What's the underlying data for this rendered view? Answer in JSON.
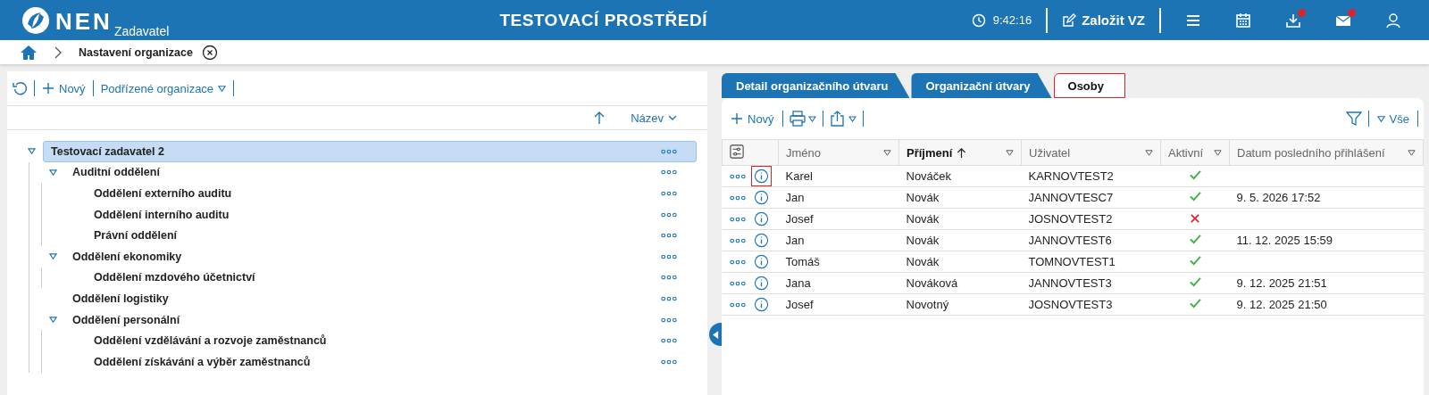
{
  "header": {
    "logo": "NEN",
    "subtitle": "Zadavatel",
    "environment": "TESTOVACÍ PROSTŘEDÍ",
    "time": "9:42:16",
    "create_button": "Založit VZ",
    "icons": [
      {
        "kind": "menu",
        "notification": false
      },
      {
        "kind": "calendar",
        "notification": false
      },
      {
        "kind": "download",
        "notification": true
      },
      {
        "kind": "mail",
        "notification": true
      },
      {
        "kind": "user",
        "notification": false
      }
    ]
  },
  "breadcrumb": {
    "current": "Nastavení organizace"
  },
  "tree_toolbar": {
    "new": "Nový",
    "subordinate": "Podřízené organizace"
  },
  "sort": {
    "label": "Název"
  },
  "tree": [
    {
      "label": "Testovací zadavatel 2",
      "selected": true,
      "expanded": true,
      "children": [
        {
          "label": "Auditní oddělení",
          "selected": false,
          "expanded": true,
          "children": [
            {
              "label": "Oddělení externího auditu",
              "selected": false
            },
            {
              "label": "Oddělení interního auditu",
              "selected": false
            },
            {
              "label": "Právní oddělení",
              "selected": false
            }
          ]
        },
        {
          "label": "Oddělení ekonomiky",
          "selected": false,
          "expanded": true,
          "children": [
            {
              "label": "Oddělení mzdového účetnictví",
              "selected": false
            }
          ]
        },
        {
          "label": "Oddělení logistiky",
          "selected": false
        },
        {
          "label": "Oddělení personální",
          "selected": false,
          "expanded": true,
          "children": [
            {
              "label": "Oddělení vzdělávání a rozvoje zaměstnanců",
              "selected": false
            },
            {
              "label": "Oddělení získávání a výběr zaměstnanců",
              "selected": false
            }
          ]
        }
      ]
    }
  ],
  "tabs": [
    {
      "label": "Detail organizačního útvaru",
      "selected": false,
      "highlighted": false
    },
    {
      "label": "Organizační útvary",
      "selected": false,
      "highlighted": false
    },
    {
      "label": "Osoby",
      "selected": true,
      "highlighted": true
    }
  ],
  "people_toolbar": {
    "new": "Nový",
    "filter": "Vše"
  },
  "table": {
    "columns": [
      {
        "label": "Jméno",
        "sorted": false
      },
      {
        "label": "Příjmení",
        "sorted": true
      },
      {
        "label": "Uživatel",
        "sorted": false
      },
      {
        "label": "Aktivní",
        "sorted": false
      },
      {
        "label": "Datum posledního přihlášení",
        "sorted": false
      }
    ],
    "rows": [
      {
        "first_name": "Karel",
        "last_name": "Nováček",
        "user": "KARNOVTEST2",
        "active": true,
        "last_login": "",
        "info_highlighted": true
      },
      {
        "first_name": "Jan",
        "last_name": "Novák",
        "user": "JANNOVTESC7",
        "active": true,
        "last_login": "9. 5. 2026 17:52",
        "info_highlighted": false
      },
      {
        "first_name": "Josef",
        "last_name": "Novák",
        "user": "JOSNOVTEST2",
        "active": false,
        "last_login": "",
        "info_highlighted": false
      },
      {
        "first_name": "Jan",
        "last_name": "Novák",
        "user": "JANNOVTEST6",
        "active": true,
        "last_login": "11. 12. 2025 15:59",
        "info_highlighted": false
      },
      {
        "first_name": "Tomáš",
        "last_name": "Novák",
        "user": "TOMNOVTEST1",
        "active": true,
        "last_login": "",
        "info_highlighted": false
      },
      {
        "first_name": "Jana",
        "last_name": "Nováková",
        "user": "JANNOVTEST3",
        "active": true,
        "last_login": "9. 12. 2025 21:51",
        "info_highlighted": false
      },
      {
        "first_name": "Josef",
        "last_name": "Novotný",
        "user": "JOSNOVTEST3",
        "active": true,
        "last_login": "9. 12. 2025 21:50",
        "info_highlighted": false
      }
    ]
  }
}
